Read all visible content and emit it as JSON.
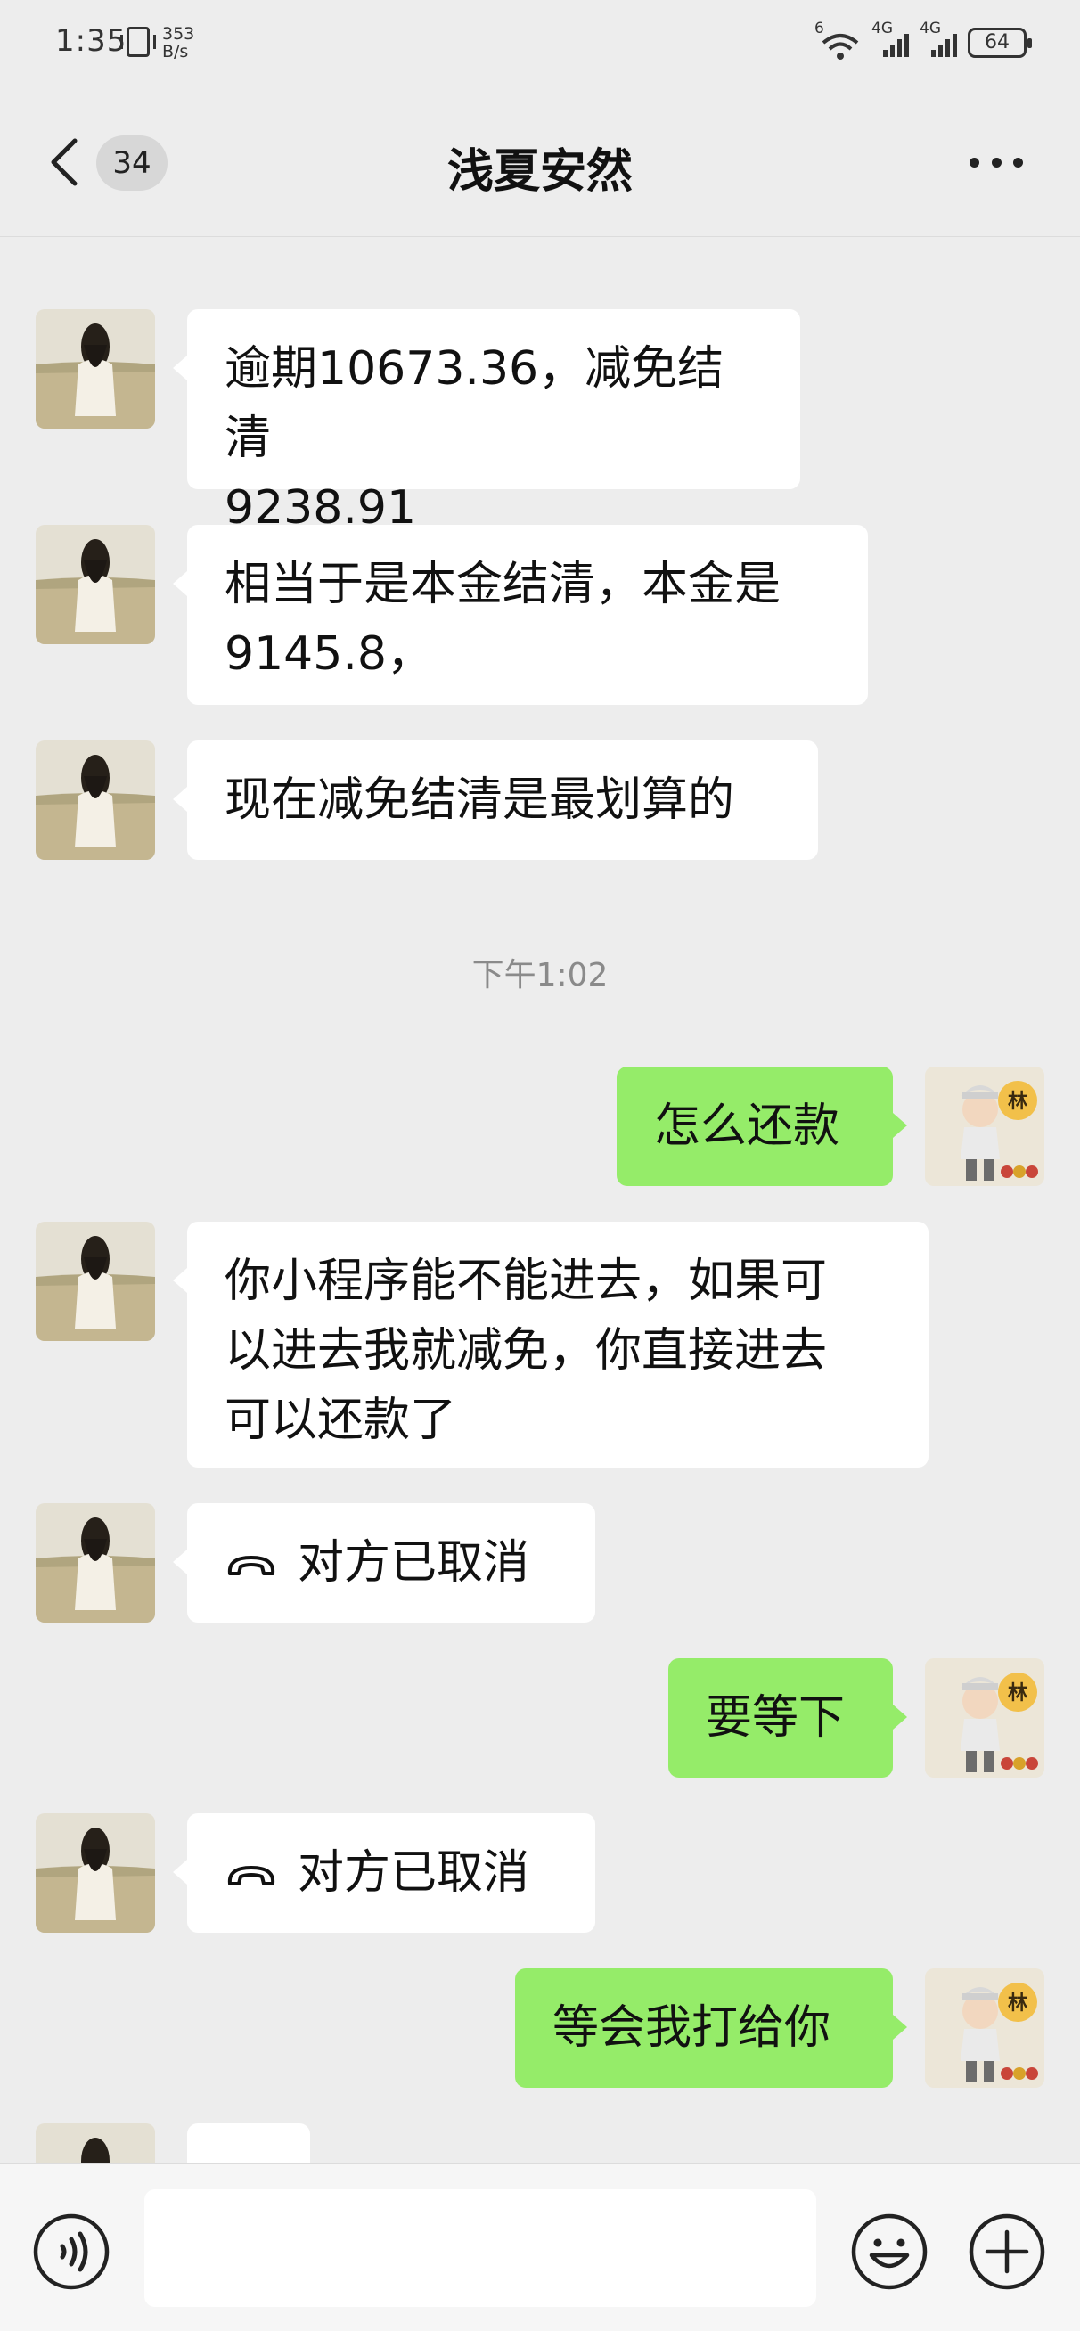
{
  "status_bar": {
    "time": "1:35",
    "net_speed_value": "353",
    "net_speed_unit": "B/s",
    "wifi_label": "6",
    "signal1_label": "4G",
    "signal2_label": "4G",
    "battery": "64",
    "icons": [
      "vibrate-icon",
      "wifi-icon",
      "signal-icon",
      "battery-icon"
    ]
  },
  "header": {
    "title": "浅夏安然",
    "unread_count": "34",
    "icons": [
      "back-icon",
      "more-icon"
    ]
  },
  "messages": [
    {
      "side": "in",
      "lines": [
        "逾期10673.36，减免结清",
        "9238.91"
      ]
    },
    {
      "side": "in",
      "lines": [
        "相当于是本金结清，本金是",
        "9145.8，"
      ]
    },
    {
      "side": "in",
      "lines": [
        "现在减免结清是最划算的"
      ]
    },
    {
      "side": "out",
      "lines": [
        "怎么还款"
      ]
    },
    {
      "side": "in",
      "lines": [
        "你小程序能不能进去，如果可",
        "以进去我就减免，你直接进去",
        "可以还款了"
      ]
    },
    {
      "side": "in",
      "type": "call",
      "lines": [
        "对方已取消"
      ]
    },
    {
      "side": "out",
      "lines": [
        "要等下"
      ]
    },
    {
      "side": "in",
      "type": "call",
      "lines": [
        "对方已取消"
      ]
    },
    {
      "side": "out",
      "lines": [
        "等会我打给你"
      ]
    }
  ],
  "timestamp": "下午1:02",
  "avatar_badge": "林",
  "colors": {
    "background": "#ededed",
    "incoming_bubble": "#ffffff",
    "outgoing_bubble": "#95ec69",
    "input_bar": "#f6f6f6"
  },
  "input_bar": {
    "icons": [
      "voice-icon",
      "emoji-icon",
      "plus-icon"
    ]
  }
}
